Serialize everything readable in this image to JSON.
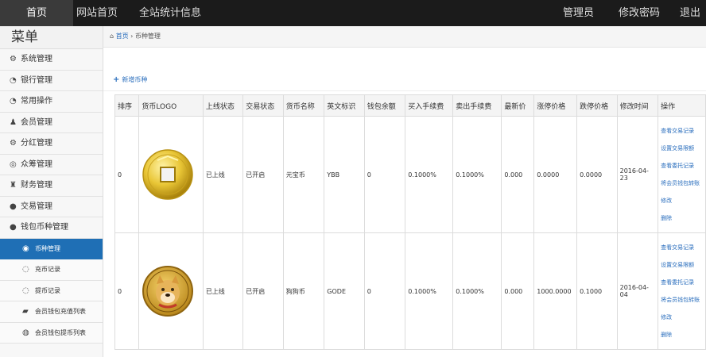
{
  "topnav": {
    "items": [
      "首页",
      "网站首页",
      "全站统计信息"
    ],
    "right": [
      "管理员",
      "修改密码",
      "退出"
    ]
  },
  "sidebar": {
    "title": "菜单",
    "items": [
      {
        "icon": "gear-icon",
        "glyph": "⚙",
        "label": "系统管理"
      },
      {
        "icon": "circle-arrow-icon",
        "glyph": "◔",
        "label": "银行管理"
      },
      {
        "icon": "circle-arrow-icon",
        "glyph": "◔",
        "label": "常用操作"
      },
      {
        "icon": "user-icon",
        "glyph": "♟",
        "label": "会员管理"
      },
      {
        "icon": "settings-icon",
        "glyph": "⚙",
        "label": "分红管理"
      },
      {
        "icon": "crowd-icon",
        "glyph": "◎",
        "label": "众筹管理"
      },
      {
        "icon": "bag-icon",
        "glyph": "♜",
        "label": "财务管理"
      },
      {
        "icon": "exchange-icon",
        "glyph": "●",
        "label": "交易管理"
      },
      {
        "icon": "wallet-icon",
        "glyph": "●",
        "label": "钱包币种管理"
      }
    ],
    "subitems": [
      {
        "icon": "coin-icon",
        "glyph": "◉",
        "label": "币种管理",
        "active": true
      },
      {
        "icon": "circle-icon",
        "glyph": "◌",
        "label": "充币记录"
      },
      {
        "icon": "circle-icon",
        "glyph": "◌",
        "label": "提币记录"
      },
      {
        "icon": "wallet-icon",
        "glyph": "▰",
        "label": "会员钱包充值列表"
      },
      {
        "icon": "circle-icon",
        "glyph": "◍",
        "label": "会员钱包提币列表"
      }
    ]
  },
  "breadcrumb": {
    "home": "首页",
    "sep": "›",
    "current": "币种管理"
  },
  "add_button": "新增币种",
  "table": {
    "headers": [
      "排序",
      "货币LOGO",
      "上线状态",
      "交易状态",
      "货币名称",
      "英文标识",
      "钱包余额",
      "买入手续费",
      "卖出手续费",
      "最新价",
      "涨停价格",
      "跌停价格",
      "修改时间",
      "操作"
    ],
    "rows": [
      {
        "sort": "0",
        "logo": "coin-gold-logo",
        "online": "已上线",
        "trade": "已开启",
        "name": "元宝币",
        "symbol": "YBB",
        "balance": "0",
        "buy_fee": "0.1000%",
        "sell_fee": "0.1000%",
        "latest": "0.000",
        "up": "0.0000",
        "down": "0.0000",
        "time": "2016-04-23"
      },
      {
        "sort": "0",
        "logo": "coin-doge-logo",
        "online": "已上线",
        "trade": "已开启",
        "name": "狗狗币",
        "symbol": "GODE",
        "balance": "0",
        "buy_fee": "0.1000%",
        "sell_fee": "0.1000%",
        "latest": "0.000",
        "up": "1000.0000",
        "down": "0.1000",
        "time": "2016-04-04"
      }
    ],
    "ops": [
      "查看交易记录",
      "设置交易限额",
      "查看委托记录",
      "将会员钱包转账",
      "修改",
      "删除"
    ]
  },
  "colors": {
    "topbar": "#1b1b1b",
    "active": "#1f6fb5",
    "link": "#2a6ebd"
  }
}
